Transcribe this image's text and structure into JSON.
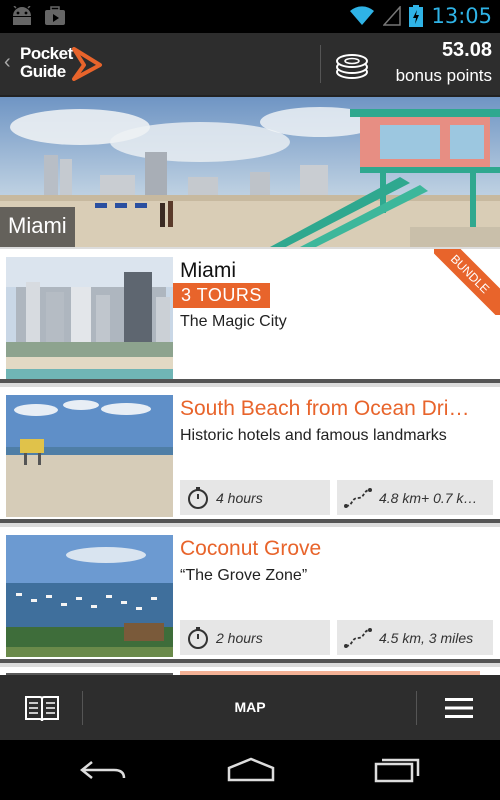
{
  "status_bar": {
    "time": "13:05",
    "left_icons": [
      "android-icon",
      "play-store-icon"
    ],
    "right_icons": [
      "wifi-icon",
      "signal-icon",
      "battery-charging-icon"
    ]
  },
  "header": {
    "logo_line1": "Pocket",
    "logo_line2": "Guide",
    "points_value": "53.08",
    "points_label": "bonus points"
  },
  "hero": {
    "title": "Miami"
  },
  "cards": [
    {
      "title": "Miami",
      "badge": "3 TOURS",
      "subtitle": "The Magic City",
      "ribbon": "BUNDLE"
    },
    {
      "title": "South Beach from Ocean Dri…",
      "subtitle": "Historic hotels and famous landmarks",
      "duration": "4 hours",
      "distance": "4.8 km+ 0.7 k…"
    },
    {
      "title": "Coconut Grove",
      "subtitle": "“The Grove Zone”",
      "duration": "2 hours",
      "distance": "4.5 km, 3 miles"
    }
  ],
  "bottom_bar": {
    "map_label": "MAP"
  },
  "colors": {
    "accent": "#e8642b",
    "header_bg": "#2d2d2d",
    "status_blue": "#2fb3e6"
  }
}
